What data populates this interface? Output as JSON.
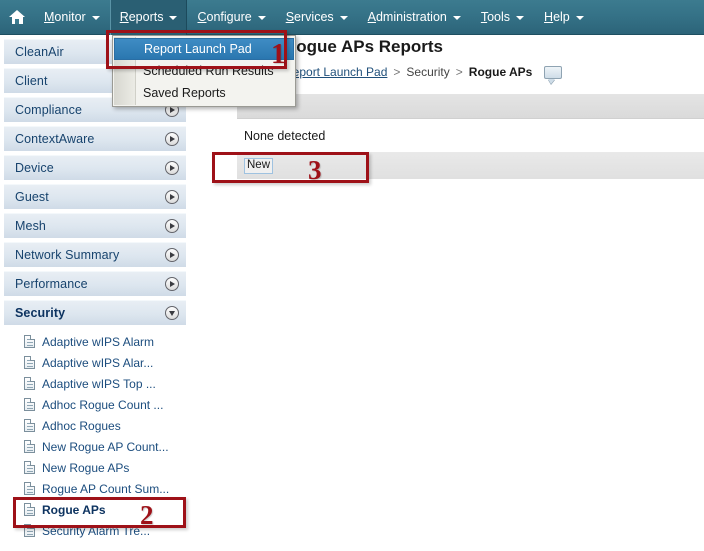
{
  "menubar": {
    "home_icon": "home-icon",
    "items": [
      {
        "label": "Monitor",
        "accel": "M",
        "open": false
      },
      {
        "label": "Reports",
        "accel": "R",
        "open": true
      },
      {
        "label": "Configure",
        "accel": "C",
        "open": false
      },
      {
        "label": "Services",
        "accel": "S",
        "open": false
      },
      {
        "label": "Administration",
        "accel": "A",
        "open": false
      },
      {
        "label": "Tools",
        "accel": "T",
        "open": false
      },
      {
        "label": "Help",
        "accel": "H",
        "open": false
      }
    ]
  },
  "dropdown": {
    "items": [
      {
        "label": "Report Launch Pad",
        "selected": true
      },
      {
        "label": "Scheduled Run Results",
        "selected": false
      },
      {
        "label": "Saved Reports",
        "selected": false
      }
    ]
  },
  "sidebar": {
    "groups": [
      {
        "label": "CleanAir",
        "expanded": false,
        "arrow": "chevron-right-icon",
        "active": false
      },
      {
        "label": "Client",
        "expanded": false,
        "arrow": "chevron-right-icon",
        "active": false
      },
      {
        "label": "Compliance",
        "expanded": false,
        "arrow": "chevron-right-icon",
        "active": false
      },
      {
        "label": "ContextAware",
        "expanded": false,
        "arrow": "chevron-right-icon",
        "active": false
      },
      {
        "label": "Device",
        "expanded": false,
        "arrow": "chevron-right-icon",
        "active": false
      },
      {
        "label": "Guest",
        "expanded": false,
        "arrow": "chevron-right-icon",
        "active": false
      },
      {
        "label": "Mesh",
        "expanded": false,
        "arrow": "chevron-right-icon",
        "active": false
      },
      {
        "label": "Network Summary",
        "expanded": false,
        "arrow": "chevron-right-icon",
        "active": false
      },
      {
        "label": "Performance",
        "expanded": false,
        "arrow": "chevron-right-icon",
        "active": false
      },
      {
        "label": "Security",
        "expanded": true,
        "arrow": "chevron-down-icon",
        "active": true
      }
    ],
    "security_reports": [
      {
        "label": "Adaptive wIPS Alarm",
        "active": false
      },
      {
        "label": "Adaptive wIPS Alar...",
        "active": false
      },
      {
        "label": "Adaptive wIPS Top ...",
        "active": false
      },
      {
        "label": "Adhoc Rogue Count ...",
        "active": false
      },
      {
        "label": "Adhoc Rogues",
        "active": false
      },
      {
        "label": "New Rogue AP Count...",
        "active": false
      },
      {
        "label": "New Rogue APs",
        "active": false
      },
      {
        "label": "Rogue AP Count Sum...",
        "active": false
      },
      {
        "label": "Rogue APs",
        "active": true
      },
      {
        "label": "Security Alarm Tre...",
        "active": false
      }
    ]
  },
  "page": {
    "title": "Rogue APs Reports",
    "breadcrumb": {
      "root": "Report Launch Pad",
      "sep": ">",
      "middle": "Security",
      "current": "Rogue APs",
      "note_icon": "speech-bubble-icon"
    }
  },
  "panel": {
    "empty_message": "None detected",
    "new_button": "New"
  },
  "annotations": [
    {
      "number": "1",
      "target": "report-launch-pad-menu-item"
    },
    {
      "number": "2",
      "target": "rogue-aps-sidebar-item"
    },
    {
      "number": "3",
      "target": "new-button"
    }
  ],
  "colors": {
    "menubar": "#357287",
    "dropdown_selected": "#2a77b0",
    "annotation_red": "#9e1118",
    "sidebar_text": "#17436d"
  }
}
